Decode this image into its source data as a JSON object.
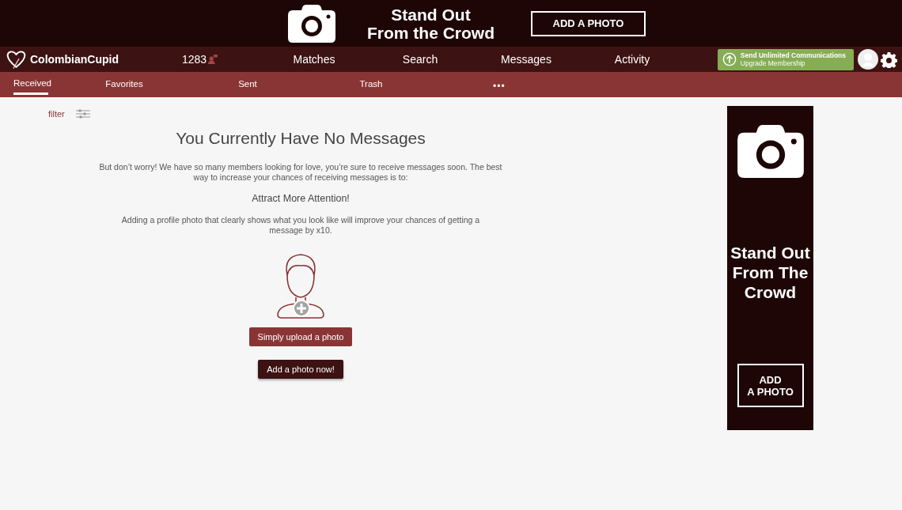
{
  "top_banner": {
    "headline": [
      "Stand Out",
      "From the Crowd"
    ],
    "button": "ADD A PHOTO"
  },
  "nav": {
    "logo": "ColombianCupid",
    "count": "1283",
    "items": [
      {
        "label": "Matches",
        "selected": false
      },
      {
        "label": "Search",
        "selected": false
      },
      {
        "label": "Messages",
        "selected": false
      },
      {
        "label": "Activity",
        "selected": false
      }
    ],
    "upgrade": {
      "title": "Send Unlimited Communications",
      "subtitle": "Upgrade Membership"
    }
  },
  "tabs": [
    {
      "label": "Received",
      "selected": true
    },
    {
      "label": "Favorites",
      "selected": false
    },
    {
      "label": "Sent",
      "selected": false
    },
    {
      "label": "Trash",
      "selected": false
    }
  ],
  "more": "•••",
  "filter": "filter",
  "empty": {
    "title": "You Currently Have No Messages",
    "text": "But don’t worry! We have so many members looking for love, you’re sure to receive messages soon. The best way to increase your chances of receiving messages is to:",
    "subtitle": "Attract More Attention!",
    "detail": "Adding a profile photo that clearly shows what you look like will improve your chances of getting a message by x10.",
    "upload_button": "Simply upload a photo",
    "add_button": "Add a photo now!"
  },
  "side_ad": {
    "headline": [
      "Stand Out",
      "From The",
      "Crowd"
    ],
    "button": [
      "ADD",
      "A PHOTO"
    ]
  }
}
